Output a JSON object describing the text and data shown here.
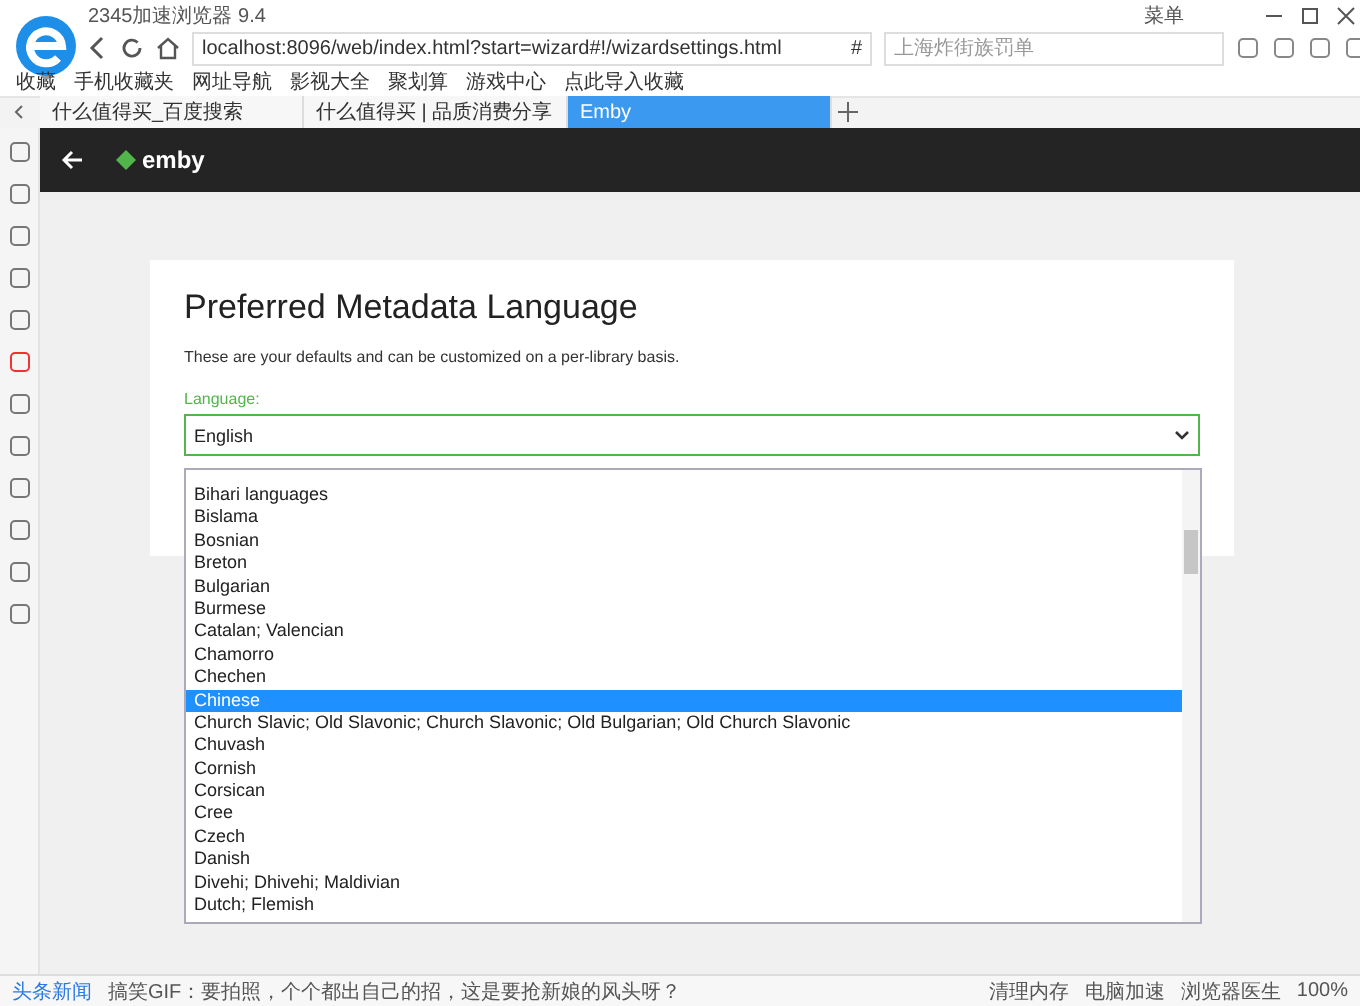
{
  "browser": {
    "title": "2345加速浏览器 9.4",
    "menu": "菜单",
    "address": "localhost:8096/web/index.html?start=wizard#!/wizardsettings.html",
    "address_extra": "#",
    "search": {
      "placeholder": "上海炸街族罚单"
    },
    "bookmarks": [
      "收藏",
      "手机收藏夹",
      "网址导航",
      "影视大全",
      "聚划算",
      "游戏中心",
      "点此导入收藏"
    ],
    "tabs": [
      {
        "label": "什么值得买_百度搜索",
        "selected": false
      },
      {
        "label": "什么值得买 | 品质消费分享",
        "selected": false
      },
      {
        "label": "Emby",
        "selected": true
      }
    ]
  },
  "app": {
    "logo": "emby"
  },
  "page": {
    "title": "Preferred Metadata Language",
    "subtitle": "These are your defaults and can be customized on a per-library basis.",
    "field_label": "Language:",
    "value": "English",
    "options": [
      {
        "label": "Bihari languages",
        "selected": false
      },
      {
        "label": "Bislama",
        "selected": false
      },
      {
        "label": "Bosnian",
        "selected": false
      },
      {
        "label": "Breton",
        "selected": false
      },
      {
        "label": "Bulgarian",
        "selected": false
      },
      {
        "label": "Burmese",
        "selected": false
      },
      {
        "label": "Catalan; Valencian",
        "selected": false
      },
      {
        "label": "Chamorro",
        "selected": false
      },
      {
        "label": "Chechen",
        "selected": false
      },
      {
        "label": "Chinese",
        "selected": true
      },
      {
        "label": "Church Slavic; Old Slavonic; Church Slavonic; Old Bulgarian; Old Church Slavonic",
        "selected": false
      },
      {
        "label": "Chuvash",
        "selected": false
      },
      {
        "label": "Cornish",
        "selected": false
      },
      {
        "label": "Corsican",
        "selected": false
      },
      {
        "label": "Cree",
        "selected": false
      },
      {
        "label": "Czech",
        "selected": false
      },
      {
        "label": "Danish",
        "selected": false
      },
      {
        "label": "Divehi; Dhivehi; Maldivian",
        "selected": false
      },
      {
        "label": "Dutch; Flemish",
        "selected": false
      }
    ]
  },
  "status_bar": {
    "news_label": "头条新闻",
    "news": "搞笑GIF：要拍照，个个都出自己的招，这是要抢新娘的风头呀？",
    "tools": [
      "清理内存",
      "电脑加速",
      "浏览器医生"
    ],
    "zoom": "100%"
  }
}
